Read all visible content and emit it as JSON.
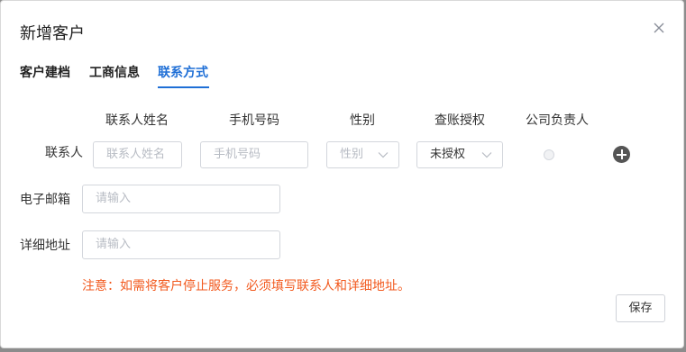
{
  "dialog": {
    "title": "新增客户",
    "close_icon": "close-icon"
  },
  "tabs": [
    {
      "label": "客户建档",
      "active": false
    },
    {
      "label": "工商信息",
      "active": false
    },
    {
      "label": "联系方式",
      "active": true
    }
  ],
  "contact_table": {
    "columns": [
      "联系人姓名",
      "手机号码",
      "性别",
      "查账授权",
      "公司负责人"
    ],
    "row_label": "联系人",
    "name_placeholder": "联系人姓名",
    "phone_placeholder": "手机号码",
    "gender_placeholder": "性别",
    "auth_value": "未授权",
    "owner_selected": false,
    "add_icon": "plus-circle-icon"
  },
  "email": {
    "label": "电子邮箱",
    "placeholder": "请输入"
  },
  "address": {
    "label": "详细地址",
    "placeholder": "请输入"
  },
  "notice": "注意：如需将客户停止服务，必须填写联系人和详细地址。",
  "footer": {
    "save_label": "保存"
  },
  "colors": {
    "accent": "#1f6fd6",
    "warning": "#f25a1f"
  }
}
